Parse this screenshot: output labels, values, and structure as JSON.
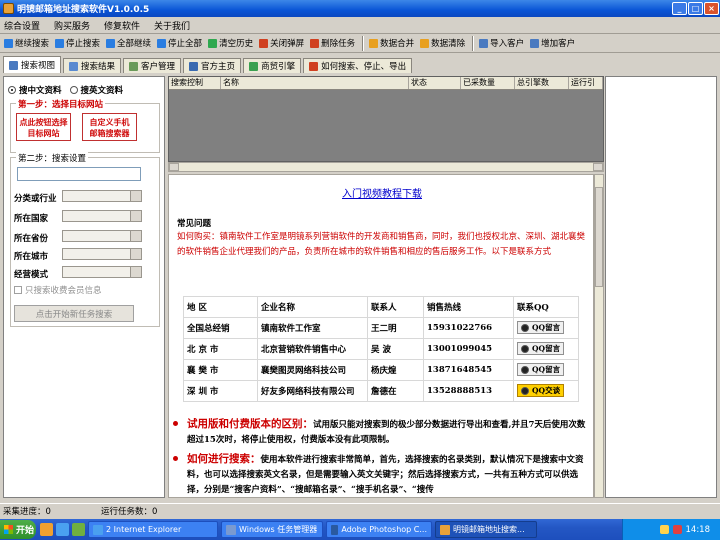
{
  "window": {
    "title": "明镜邮箱地址搜索软件V1.0.0.5",
    "btn_min": "_",
    "btn_max": "□",
    "btn_close": "×"
  },
  "menu": [
    "综合设置",
    "购买服务",
    "修复软件",
    "关于我们"
  ],
  "toolbar": [
    {
      "label": "继续搜索",
      "color": "#2a7de1"
    },
    {
      "label": "停止搜索",
      "color": "#2a7de1"
    },
    {
      "label": "全部继续",
      "color": "#2a7de1"
    },
    {
      "label": "停止全部",
      "color": "#2a7de1"
    },
    {
      "label": "清空历史",
      "color": "#2fa84f"
    },
    {
      "label": "关闭弹屏",
      "color": "#d04020"
    },
    {
      "label": "删除任务",
      "color": "#d04020"
    },
    {
      "label": "数据合并",
      "color": "#e8a020"
    },
    {
      "label": "数据清除",
      "color": "#e8a020"
    },
    {
      "label": "导入客户",
      "color": "#4a7ac0"
    },
    {
      "label": "增加客户",
      "color": "#4a7ac0"
    }
  ],
  "tabs": [
    {
      "label": "搜索视图",
      "active": true
    },
    {
      "label": "搜索结果",
      "active": false
    },
    {
      "label": "客户管理",
      "active": false
    },
    {
      "label": "官方主页",
      "active": false
    },
    {
      "label": "商贸引擎",
      "active": false
    },
    {
      "label": "如何搜索、停止、导出",
      "active": false
    }
  ],
  "left": {
    "radio1": "搜中文资料",
    "radio2": "搜英文资料",
    "step1": "第一步：选择目标网站",
    "btn1_l1": "点此按钮选择",
    "btn1_l2": "目标网站",
    "btn2_l1": "自定义手机",
    "btn2_l2": "邮箱搜索器",
    "step2": "第二步：搜索设置",
    "f_category": "分类或行业",
    "f_country": "所在国家",
    "f_province": "所在省份",
    "f_city": "所在城市",
    "f_mode": "经营模式",
    "checkbox": "只搜索收费会员信息",
    "start_btn": "点击开始新任务搜索"
  },
  "grid_columns": [
    "搜索控制",
    "名称",
    "状态",
    "已采数量",
    "总引擎数",
    "运行引"
  ],
  "content": {
    "link": "入门视频教程下载",
    "faq_title": "常见问题",
    "faq_text": "如何购买：镇南软件工作室是明镜系列营销软件的开发商和销售商，同时，我们也授权北京、深圳、湖北襄樊的软件销售企业代理我们的产品，负责所在城市的软件销售和相应的售后服务工作。以下是联系方式",
    "table_header": [
      "地 区",
      "企业名称",
      "联系人",
      "销售热线",
      "联系QQ"
    ],
    "table_rows": [
      [
        "全国总经销",
        "镇南软件工作室",
        "王二明",
        "15931022766",
        "QQ留言"
      ],
      [
        "北 京 市",
        "北京营销软件销售中心",
        "吴 波",
        "13001099045",
        "QQ留言"
      ],
      [
        "襄 樊 市",
        "襄樊图灵网络科技公司",
        "杨庆煌",
        "13871648545",
        "QQ留言"
      ],
      [
        "深 圳 市",
        "好友多网络科技有限公司",
        "詹德在",
        "13528888513",
        "QQ交谈"
      ]
    ],
    "b1_head": "试用版和付费版本的区别：",
    "b1_body": "试用版只能对搜索到的极少部分数据进行导出和查看,并且7天后使用次数超过15次时，将停止使用权，付费版本没有此项限制。",
    "b2_head": "如何进行搜索：",
    "b2_body": "使用本软件进行搜索非常简单，首先，选择搜索的名录类别，默认情况下是搜索中文资料，也可以选择搜索英文名录，但是需要输入英文关键字；然后选择搜索方式，一共有五种方式可以供选择，分别是“搜客户资料”、“搜邮箱名录”、“搜手机名录”、“搜传"
  },
  "status": {
    "progress": "采集进度：0",
    "tasks": "运行任务数：0"
  },
  "taskbar": {
    "start": "开始",
    "tasks": [
      {
        "label": "2 Internet Explorer",
        "color": "#4aa0f0",
        "active": false
      },
      {
        "label": "Windows 任务管理器",
        "color": "#7a9ad0",
        "active": false
      },
      {
        "label": "Adobe Photoshop C...",
        "color": "#2a5aa0",
        "active": false
      },
      {
        "label": "明镜邮箱地址搜索...",
        "color": "#e8a23a",
        "active": true
      }
    ],
    "clock": "14:18"
  }
}
